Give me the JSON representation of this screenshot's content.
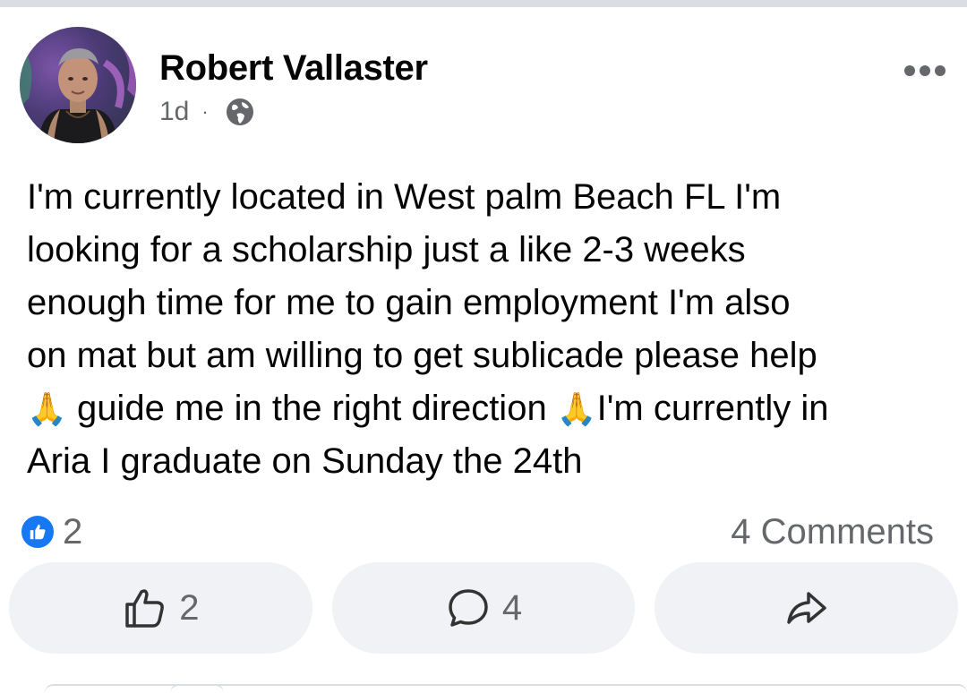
{
  "post": {
    "author": "Robert Vallaster",
    "time": "1d",
    "separator": "·",
    "audience_icon": "globe-icon",
    "more_icon": "more-horizontal-icon",
    "text_lines": [
      "I'm currently located in West palm Beach FL I'm",
      "looking for a scholarship just a like 2-3 weeks",
      "enough time for me to gain employment I'm also",
      "on mat but am willing to get sublicade please help"
    ],
    "text_line5_a": "🙏",
    "text_line5_b": " guide me in the right direction ",
    "text_line5_c": "🙏",
    "text_line5_d": "I'm currently in",
    "text_line6": "Aria I graduate on Sunday the 24th"
  },
  "stats": {
    "reaction_count": "2",
    "reaction_icon": "like-badge-icon",
    "comments_label": "4 Comments"
  },
  "actions": {
    "like_count": "2",
    "comment_count": "4",
    "like_icon": "thumbs-up-icon",
    "comment_icon": "comment-bubble-icon",
    "share_icon": "share-arrow-icon"
  },
  "colors": {
    "brand_blue": "#1877f2",
    "secondary_text": "#65676b",
    "button_bg": "#f0f2f5"
  }
}
